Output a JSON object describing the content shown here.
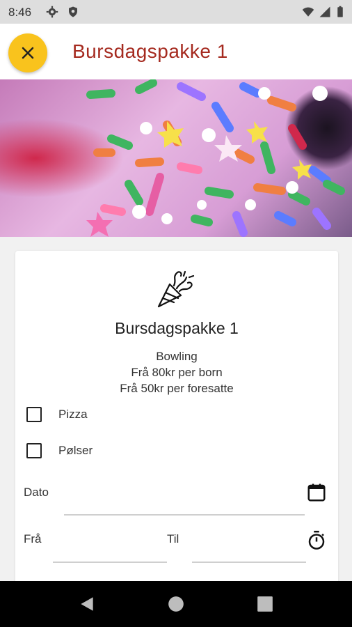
{
  "status_bar": {
    "time": "8:46"
  },
  "app_bar": {
    "title": "Bursdagspakke 1"
  },
  "card": {
    "package_name": "Bursdagspakke 1",
    "description_lines": [
      "Bowling",
      "Frå 80kr per born",
      "Frå 50kr per foresatte"
    ],
    "options": [
      {
        "label": "Pizza",
        "checked": false
      },
      {
        "label": "Pølser",
        "checked": false
      }
    ],
    "date_label": "Dato",
    "from_label": "Frå",
    "to_label": "Til"
  },
  "colors": {
    "accent": "#f9c31d",
    "title": "#a52a1f"
  }
}
